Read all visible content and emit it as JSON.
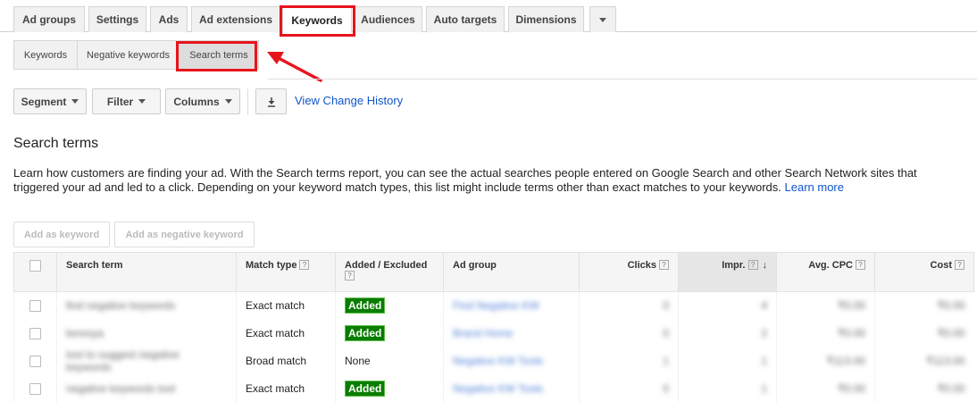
{
  "top_tabs": [
    {
      "label": "Ad groups"
    },
    {
      "label": "Settings"
    },
    {
      "label": "Ads"
    },
    {
      "label": "Ad extensions"
    },
    {
      "label": "Keywords",
      "active": true
    },
    {
      "label": "Audiences"
    },
    {
      "label": "Auto targets"
    },
    {
      "label": "Dimensions"
    }
  ],
  "sub_tabs": [
    {
      "label": "Keywords"
    },
    {
      "label": "Negative keywords"
    },
    {
      "label": "Search terms",
      "active": true
    }
  ],
  "toolbar": {
    "segment": "Segment",
    "filter": "Filter",
    "columns": "Columns",
    "history_link": "View Change History"
  },
  "section": {
    "title": "Search terms",
    "description": "Learn how customers are finding your ad. With the Search terms report, you can see the actual searches people entered on Google Search and other Search Network sites that triggered your ad and led to a click. Depending on your keyword match types, this list might include terms other than exact matches to your keywords.",
    "learn_more": "Learn more"
  },
  "actions": {
    "add_keyword": "Add as keyword",
    "add_negative": "Add as negative keyword"
  },
  "table": {
    "headers": {
      "search_term": "Search term",
      "match_type": "Match type",
      "added_excluded": "Added / Excluded",
      "ad_group": "Ad group",
      "clicks": "Clicks",
      "impr": "Impr.",
      "avg_cpc": "Avg. CPC",
      "cost": "Cost"
    },
    "help_mark": "?",
    "rows": [
      {
        "term": "find negative keywords",
        "match": "Exact match",
        "status": "Added",
        "group": "Find Negative KW",
        "clicks": "0",
        "impr": "4",
        "cpc": "₹0.00",
        "cost": "₹0.00"
      },
      {
        "term": "keresya",
        "match": "Exact match",
        "status": "Added",
        "group": "Brand Home",
        "clicks": "0",
        "impr": "2",
        "cpc": "₹0.00",
        "cost": "₹0.00"
      },
      {
        "term": "tool to suggest negative keywords",
        "match": "Broad match",
        "status": "None",
        "group": "Negative KW Tools",
        "clicks": "1",
        "impr": "1",
        "cpc": "₹113.00",
        "cost": "₹113.00"
      },
      {
        "term": "negative keywords tool",
        "match": "Exact match",
        "status": "Added",
        "group": "Negative KW Tools",
        "clicks": "0",
        "impr": "1",
        "cpc": "₹0.00",
        "cost": "₹0.00"
      }
    ]
  },
  "colors": {
    "highlight": "#e8141c",
    "added_badge": "#0a7d00",
    "link": "#1155cc"
  }
}
